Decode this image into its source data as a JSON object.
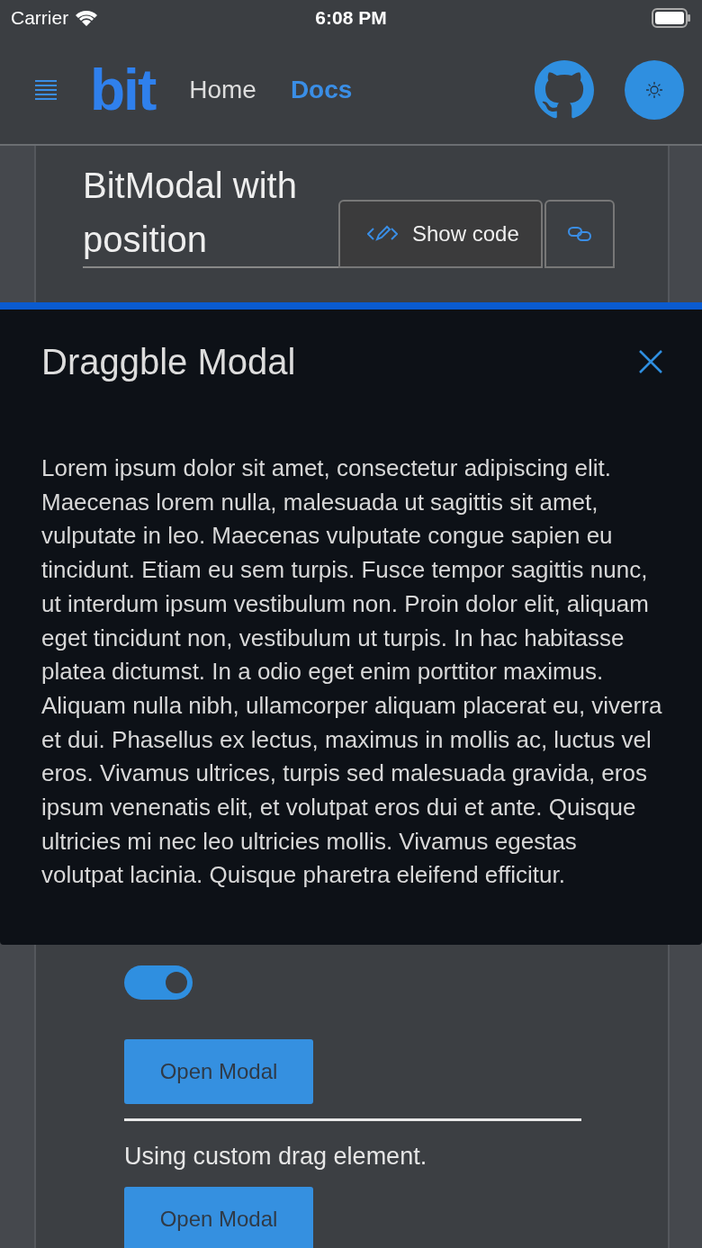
{
  "status_bar": {
    "carrier": "Carrier",
    "time": "6:08 PM"
  },
  "header": {
    "logo": "bit",
    "nav": [
      {
        "label": "Home",
        "selected": false
      },
      {
        "label": "Docs",
        "selected": true
      }
    ]
  },
  "section": {
    "title": "BitModal with position",
    "show_code": "Show code"
  },
  "toggle": {
    "on": true
  },
  "buttons": [
    {
      "label": "Open Modal"
    }
  ],
  "custom_drag": {
    "text": "Using custom drag element.",
    "button": "Open Modal"
  },
  "modal": {
    "title": "Draggble Modal",
    "body": "Lorem ipsum dolor sit amet, consectetur adipiscing elit. Maecenas lorem nulla, malesuada ut sagittis sit amet, vulputate in leo. Maecenas vulputate congue sapien eu tincidunt. Etiam eu sem turpis. Fusce tempor sagittis nunc, ut interdum ipsum vestibulum non. Proin dolor elit, aliquam eget tincidunt non, vestibulum ut turpis. In hac habitasse platea dictumst. In a odio eget enim porttitor maximus. Aliquam nulla nibh, ullamcorper aliquam placerat eu, viverra et dui. Phasellus ex lectus, maximus in mollis ac, luctus vel eros. Vivamus ultrices, turpis sed malesuada gravida, eros ipsum venenatis elit, et volutpat eros dui et ante. Quisque ultricies mi nec leo ultricies mollis. Vivamus egestas volutpat lacinia. Quisque pharetra eleifend efficitur."
  }
}
